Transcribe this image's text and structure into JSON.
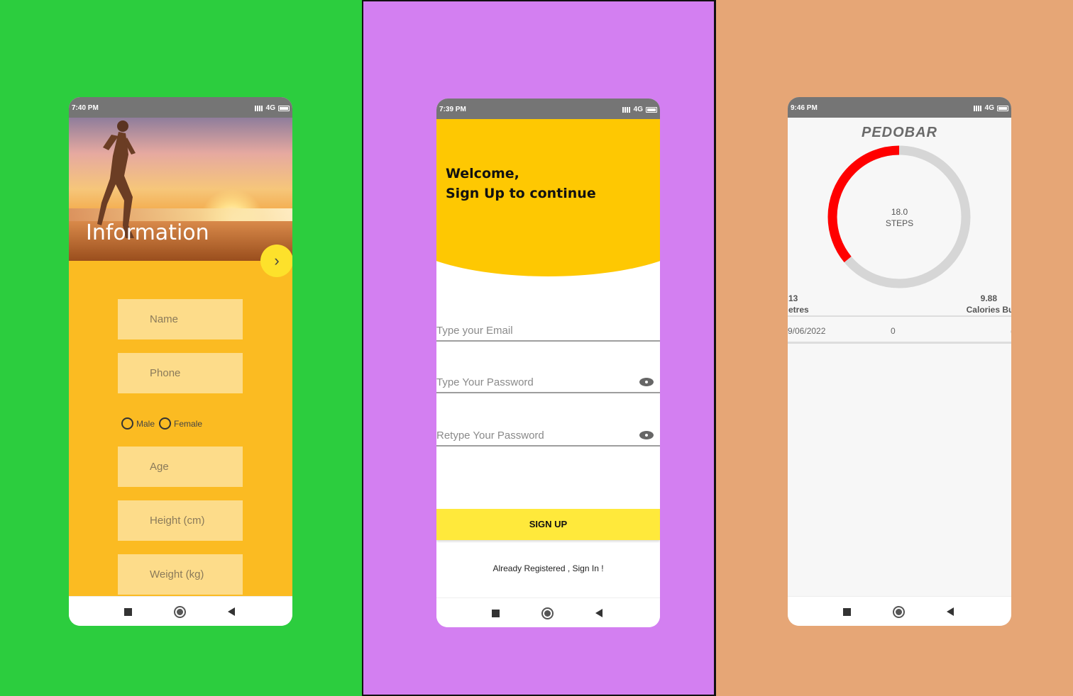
{
  "panels": [
    {
      "bg": "#2ccd3e",
      "phone": {
        "status_time": "7:40 PM",
        "status_net": "4G",
        "hero_title": "Information",
        "fields": [
          "Name",
          "Phone",
          "Age",
          "Height (cm)",
          "Weight (kg)"
        ],
        "gender_options": [
          "Male",
          "Female"
        ],
        "next_icon": "chevron-right-icon"
      }
    },
    {
      "bg": "#d37ff1",
      "phone": {
        "status_time": "7:39 PM",
        "status_net": "4G",
        "welcome_line1": "Welcome,",
        "welcome_line2": "Sign Up to continue",
        "email_placeholder": "Type your Email",
        "password_placeholder": "Type Your Password",
        "retype_placeholder": "Retype Your Password",
        "signup_label": "SIGN UP",
        "already_label": "Already Registered , Sign In !"
      }
    },
    {
      "bg": "#e6a676",
      "phone": {
        "status_time": "9:46 PM",
        "status_net": "4G",
        "title": "PEDOBAR",
        "steps_value": "18.0",
        "steps_label": "STEPS",
        "progress_fraction": 0.36,
        "stat_left_value": "13",
        "stat_left_label": "etres",
        "stat_right_value": "9.88",
        "stat_right_label": "Calories Bur",
        "history": {
          "date": "9/06/2022",
          "steps": "0",
          "extra": "("
        }
      }
    }
  ],
  "colors": {
    "accent_yellow": "#fec802",
    "progress_red": "#ff0000",
    "track_gray": "#d6d6d6"
  }
}
